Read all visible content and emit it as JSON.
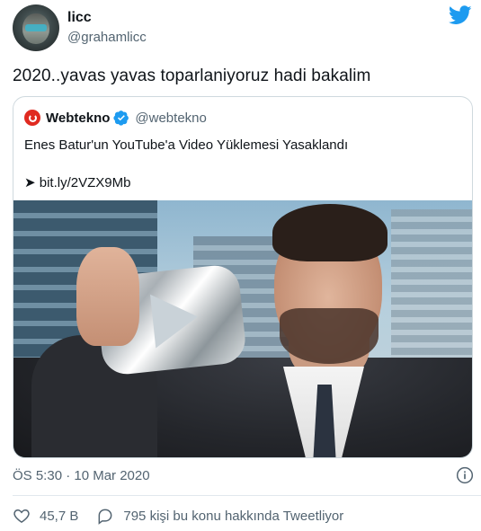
{
  "tweet": {
    "author_name": "licc",
    "author_handle": "@grahamlicc",
    "text": "2020..yavas yavas toparlaniyoruz hadi bakalim",
    "timestamp": "ÖS 5:30 · 10 Mar 2020"
  },
  "quoted": {
    "source_name": "Webtekno",
    "source_handle": "@webtekno",
    "headline": "Enes Batur'un YouTube'a Video Yüklemesi Yasaklandı",
    "link": "➤ bit.ly/2VZX9Mb"
  },
  "actions": {
    "likes": "45,7 B",
    "talking": "795 kişi bu konu hakkında Tweetliyor"
  },
  "colors": {
    "twitter_blue": "#1d9bf0",
    "muted_text": "#536471",
    "brand_red": "#e02a20"
  },
  "icons": [
    "twitter-logo-icon",
    "verified-badge-icon",
    "info-icon",
    "heart-icon",
    "chat-bubble-icon"
  ]
}
